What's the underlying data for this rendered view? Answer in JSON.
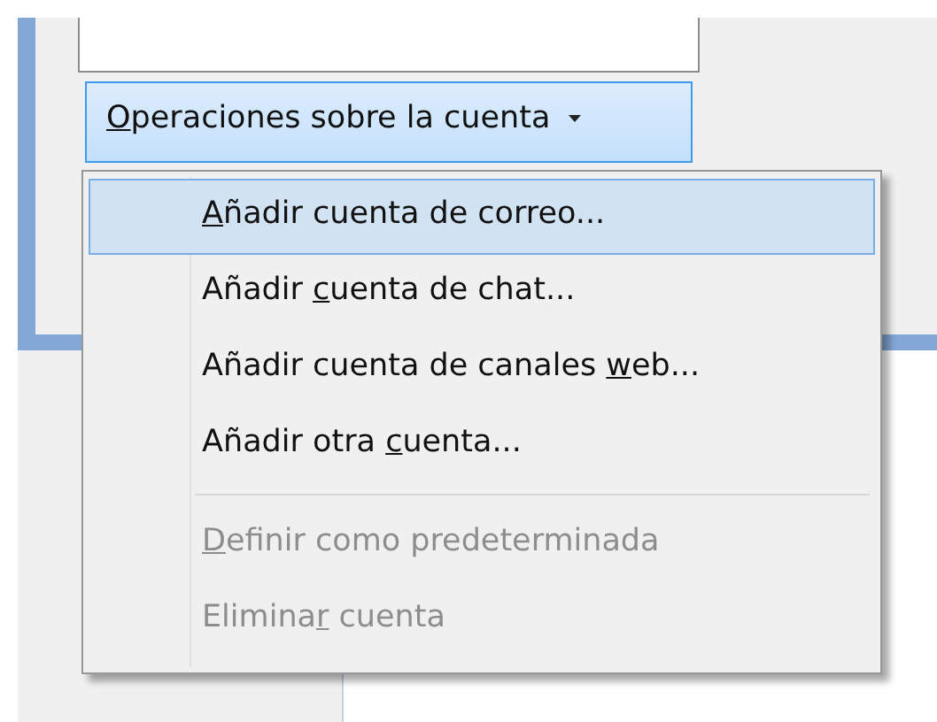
{
  "account_button": {
    "access_key": "O",
    "label_end": "peraciones sobre la cuenta",
    "expanded": true
  },
  "menu": {
    "items": [
      {
        "kind": "item",
        "access_key": "A",
        "label_end": "ñadir cuenta de correo...",
        "selected": true,
        "disabled": false
      },
      {
        "kind": "item",
        "label_start": "Añadir ",
        "access_key": "c",
        "label_end": "uenta de chat...",
        "selected": false,
        "disabled": false
      },
      {
        "kind": "item",
        "label_start": "Añadir cuenta de canales ",
        "access_key": "w",
        "label_end": "eb...",
        "selected": false,
        "disabled": false
      },
      {
        "kind": "item",
        "label_start": "Añadir otra ",
        "access_key": "c",
        "label_end": "uenta...",
        "selected": false,
        "disabled": false
      },
      {
        "kind": "separator"
      },
      {
        "kind": "item",
        "access_key": "D",
        "label_end": "efinir como predeterminada",
        "selected": false,
        "disabled": true
      },
      {
        "kind": "item",
        "label_start": "Elimina",
        "access_key": "r",
        "label_end": " cuenta",
        "selected": false,
        "disabled": true
      }
    ]
  }
}
